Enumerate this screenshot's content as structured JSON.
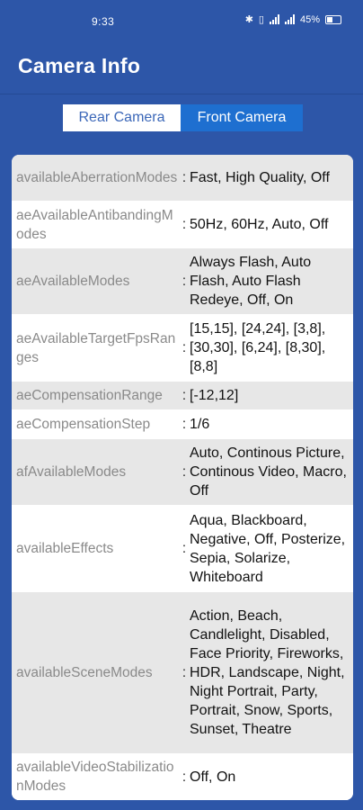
{
  "status": {
    "time": "9:33",
    "battery": "45%"
  },
  "app": {
    "title": "Camera Info"
  },
  "tabs": [
    {
      "label": "Rear Camera"
    },
    {
      "label": "Front Camera"
    }
  ],
  "rows": [
    {
      "key": "availableAberrationModes",
      "value": "Fast, High Quality, Off"
    },
    {
      "key": "aeAvailableAntibandingModes",
      "value": "50Hz, 60Hz, Auto, Off"
    },
    {
      "key": "aeAvailableModes",
      "value": "Always Flash, Auto Flash, Auto Flash Redeye, Off, On"
    },
    {
      "key": "aeAvailableTargetFpsRanges",
      "value": "[15,15], [24,24], [3,8], [30,30], [6,24], [8,30], [8,8]"
    },
    {
      "key": "aeCompensationRange",
      "value": "[-12,12]"
    },
    {
      "key": "aeCompensationStep",
      "value": "1/6"
    },
    {
      "key": "afAvailableModes",
      "value": "Auto, Continous Picture, Continous Video, Macro, Off"
    },
    {
      "key": "availableEffects",
      "value": "Aqua, Blackboard, Negative, Off, Posterize, Sepia, Solarize, Whiteboard"
    },
    {
      "key": "availableSceneModes",
      "value": "Action, Beach, Candlelight, Disabled, Face Priority, Fireworks, HDR, Landscape, Night, Night Portrait, Party, Portrait, Snow, Sports, Sunset, Theatre"
    },
    {
      "key": "availableVideoStabilizationModes",
      "value": "Off, On"
    }
  ],
  "separator": ":"
}
